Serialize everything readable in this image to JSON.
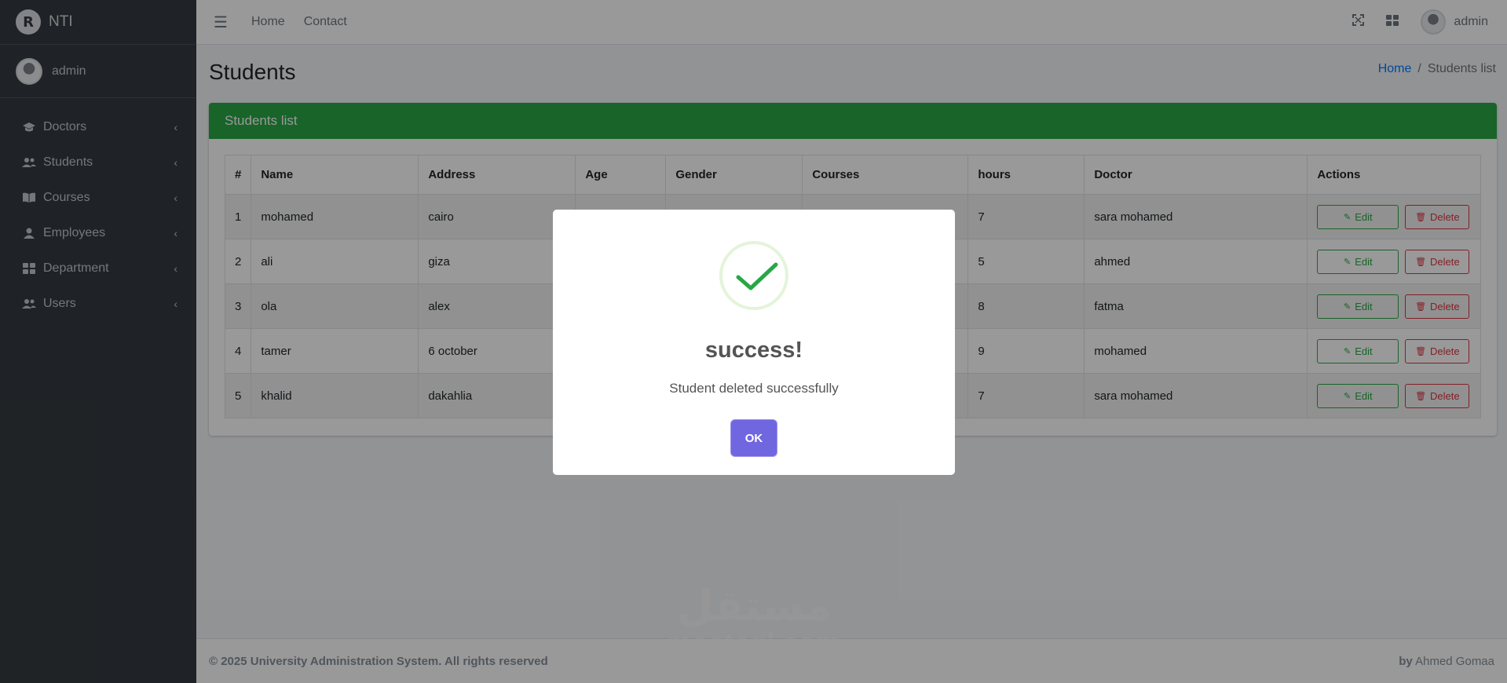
{
  "brand": {
    "name": "NTI",
    "logo_letter": "R"
  },
  "sidebar": {
    "user": "admin",
    "items": [
      {
        "label": "Doctors",
        "icon": "graduation-cap-icon",
        "glyph": "🎓"
      },
      {
        "label": "Students",
        "icon": "users-icon",
        "glyph": "👥"
      },
      {
        "label": "Courses",
        "icon": "book-icon",
        "glyph": "📖"
      },
      {
        "label": "Employees",
        "icon": "user-icon",
        "glyph": "👤"
      },
      {
        "label": "Department",
        "icon": "grid-icon",
        "glyph": "▦"
      },
      {
        "label": "Users",
        "icon": "users-icon",
        "glyph": "👥"
      }
    ]
  },
  "topbar": {
    "links": [
      "Home",
      "Contact"
    ],
    "user": "admin"
  },
  "page": {
    "title": "Students",
    "breadcrumb": {
      "home": "Home",
      "separator": "/",
      "current": "Students list"
    }
  },
  "card": {
    "title": "Students list",
    "columns": [
      "#",
      "Name",
      "Address",
      "Age",
      "Gender",
      "Courses",
      "hours",
      "Doctor",
      "Actions"
    ],
    "rows": [
      {
        "num": "1",
        "name": "mohamed",
        "address": "cairo",
        "age": "",
        "gender": "",
        "courses": "",
        "hours": "7",
        "doctor": "sara mohamed"
      },
      {
        "num": "2",
        "name": "ali",
        "address": "giza",
        "age": "",
        "gender": "",
        "courses": "",
        "hours": "5",
        "doctor": "ahmed"
      },
      {
        "num": "3",
        "name": "ola",
        "address": "alex",
        "age": "",
        "gender": "",
        "courses": "",
        "hours": "8",
        "doctor": "fatma"
      },
      {
        "num": "4",
        "name": "tamer",
        "address": "6 october",
        "age": "",
        "gender": "",
        "courses": "",
        "hours": "9",
        "doctor": "mohamed"
      },
      {
        "num": "5",
        "name": "khalid",
        "address": "dakahlia",
        "age": "",
        "gender": "",
        "courses": "",
        "hours": "7",
        "doctor": "sara mohamed"
      }
    ],
    "edit_label": "Edit",
    "delete_label": "Delete"
  },
  "footer": {
    "copyright": "© 2025 University Administration System. All rights reserved",
    "by_prefix": "by",
    "author": "Ahmed Gomaa"
  },
  "watermark": {
    "arabic": "مستقل",
    "latin": "mostaql.com"
  },
  "modal": {
    "title": "success!",
    "text": "Student deleted successfully",
    "ok_label": "OK",
    "accent_color": "#7066e0",
    "check_color": "#28a745"
  }
}
